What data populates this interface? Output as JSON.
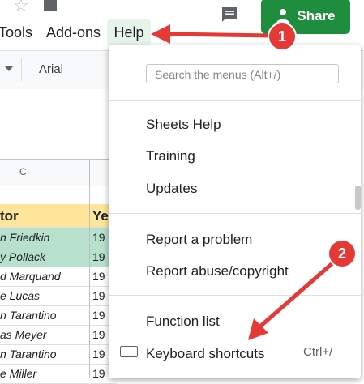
{
  "menubar": {
    "tools": "Tools",
    "addons": "Add-ons",
    "help": "Help"
  },
  "share": {
    "label": "Share"
  },
  "toolbar": {
    "font": "Arial"
  },
  "grid": {
    "column_header": "C",
    "header_cells": {
      "c": "tor",
      "d": "Ye"
    },
    "rows": [
      {
        "c": "n Friedkin",
        "d": "19",
        "highlight": true
      },
      {
        "c": "y Pollack",
        "d": "19",
        "highlight": true
      },
      {
        "c": "d Marquand",
        "d": "19",
        "highlight": false
      },
      {
        "c": "e Lucas",
        "d": "19",
        "highlight": false
      },
      {
        "c": "n Tarantino",
        "d": "19",
        "highlight": false
      },
      {
        "c": "as Meyer",
        "d": "19",
        "highlight": false
      },
      {
        "c": "n Tarantino",
        "d": "19",
        "highlight": false
      },
      {
        "c": "e Miller",
        "d": "19",
        "highlight": false
      }
    ]
  },
  "help_menu": {
    "search_placeholder": "Search the menus (Alt+/)",
    "items": {
      "sheets_help": "Sheets Help",
      "training": "Training",
      "updates": "Updates",
      "report_problem": "Report a problem",
      "report_abuse": "Report abuse/copyright",
      "function_list": "Function list",
      "keyboard_shortcuts": "Keyboard shortcuts",
      "keyboard_shortcut_key": "Ctrl+/"
    }
  },
  "annotations": {
    "badge1": "1",
    "badge2": "2"
  },
  "colors": {
    "share_green": "#1e8e3e",
    "highlight_green": "#b7e1cd",
    "header_yellow": "#ffe599",
    "annotation_red": "#e53935"
  },
  "icons": [
    "star-icon",
    "doc-icon",
    "comment-icon",
    "person-icon",
    "dropdown-arrow-icon",
    "keyboard-icon"
  ]
}
